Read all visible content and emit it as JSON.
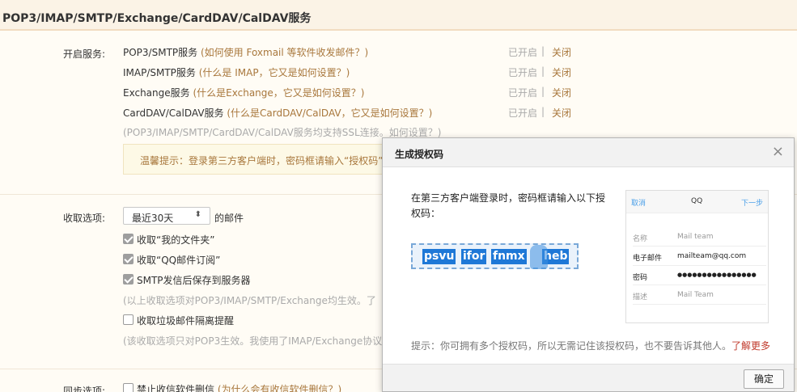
{
  "header": {
    "title": "POP3/IMAP/SMTP/Exchange/CardDAV/CalDAV服务"
  },
  "services": {
    "label": "开启服务:",
    "items": [
      {
        "name": "POP3/SMTP服务",
        "help": "(如何使用 Foxmail 等软件收发邮件？)",
        "status_on": "已开启",
        "status_off": "关闭"
      },
      {
        "name": "IMAP/SMTP服务",
        "help": "(什么是 IMAP，它又是如何设置？)",
        "status_on": "已开启",
        "status_off": "关闭"
      },
      {
        "name": "Exchange服务",
        "help": "(什么是Exchange，它又是如何设置？)",
        "status_on": "已开启",
        "status_off": "关闭"
      },
      {
        "name": "CardDAV/CalDAV服务",
        "help": "(什么是CardDAV/CalDAV，它又是如何设置？)",
        "status_on": "已开启",
        "status_off": "关闭"
      }
    ],
    "ssl_note": "(POP3/IMAP/SMTP/CardDAV/CalDAV服务均支持SSL连接。如何设置？)",
    "tip": "温馨提示：登录第三方客户端时，密码框请输入“授权码”"
  },
  "receive": {
    "label": "收取选项:",
    "range_value": "最近30天",
    "range_suffix": "的邮件",
    "options": [
      {
        "label": "收取“我的文件夹”"
      },
      {
        "label": "收取“QQ邮件订阅”"
      },
      {
        "label": "SMTP发信后保存到服务器"
      }
    ],
    "note1": "(以上收取选项对POP3/IMAP/SMTP/Exchange均生效。了",
    "junk_label": "收取垃圾邮件隔离提醒",
    "note2": "(该收取选项只对POP3生效。我使用了IMAP/Exchange协议"
  },
  "sync": {
    "label": "同步选项:",
    "option_label": "禁止收信软件删信",
    "option_help": "(为什么会有收信软件删信？)"
  },
  "dialog": {
    "title": "生成授权码",
    "close": "×",
    "instruction": "在第三方客户端登录时，密码框请输入以下授权码：",
    "code_segments": [
      "psvu",
      "ifor",
      "fnmx",
      "heb"
    ],
    "phone": {
      "cancel": "取消",
      "title": "QQ",
      "next": "下一步",
      "rows": [
        {
          "key": "名称",
          "value": "Mail team"
        },
        {
          "key": "电子邮件",
          "value": "mailteam@qq.com"
        },
        {
          "key": "密码",
          "value": "●●●●●●●●●●●●●●●●"
        },
        {
          "key": "描述",
          "value": "Mail Team"
        }
      ]
    },
    "hint": "提示：你可拥有多个授权码，所以无需记住该授权码，也不要告诉其他人。",
    "learn_more": "了解更多",
    "ok": "确定"
  }
}
